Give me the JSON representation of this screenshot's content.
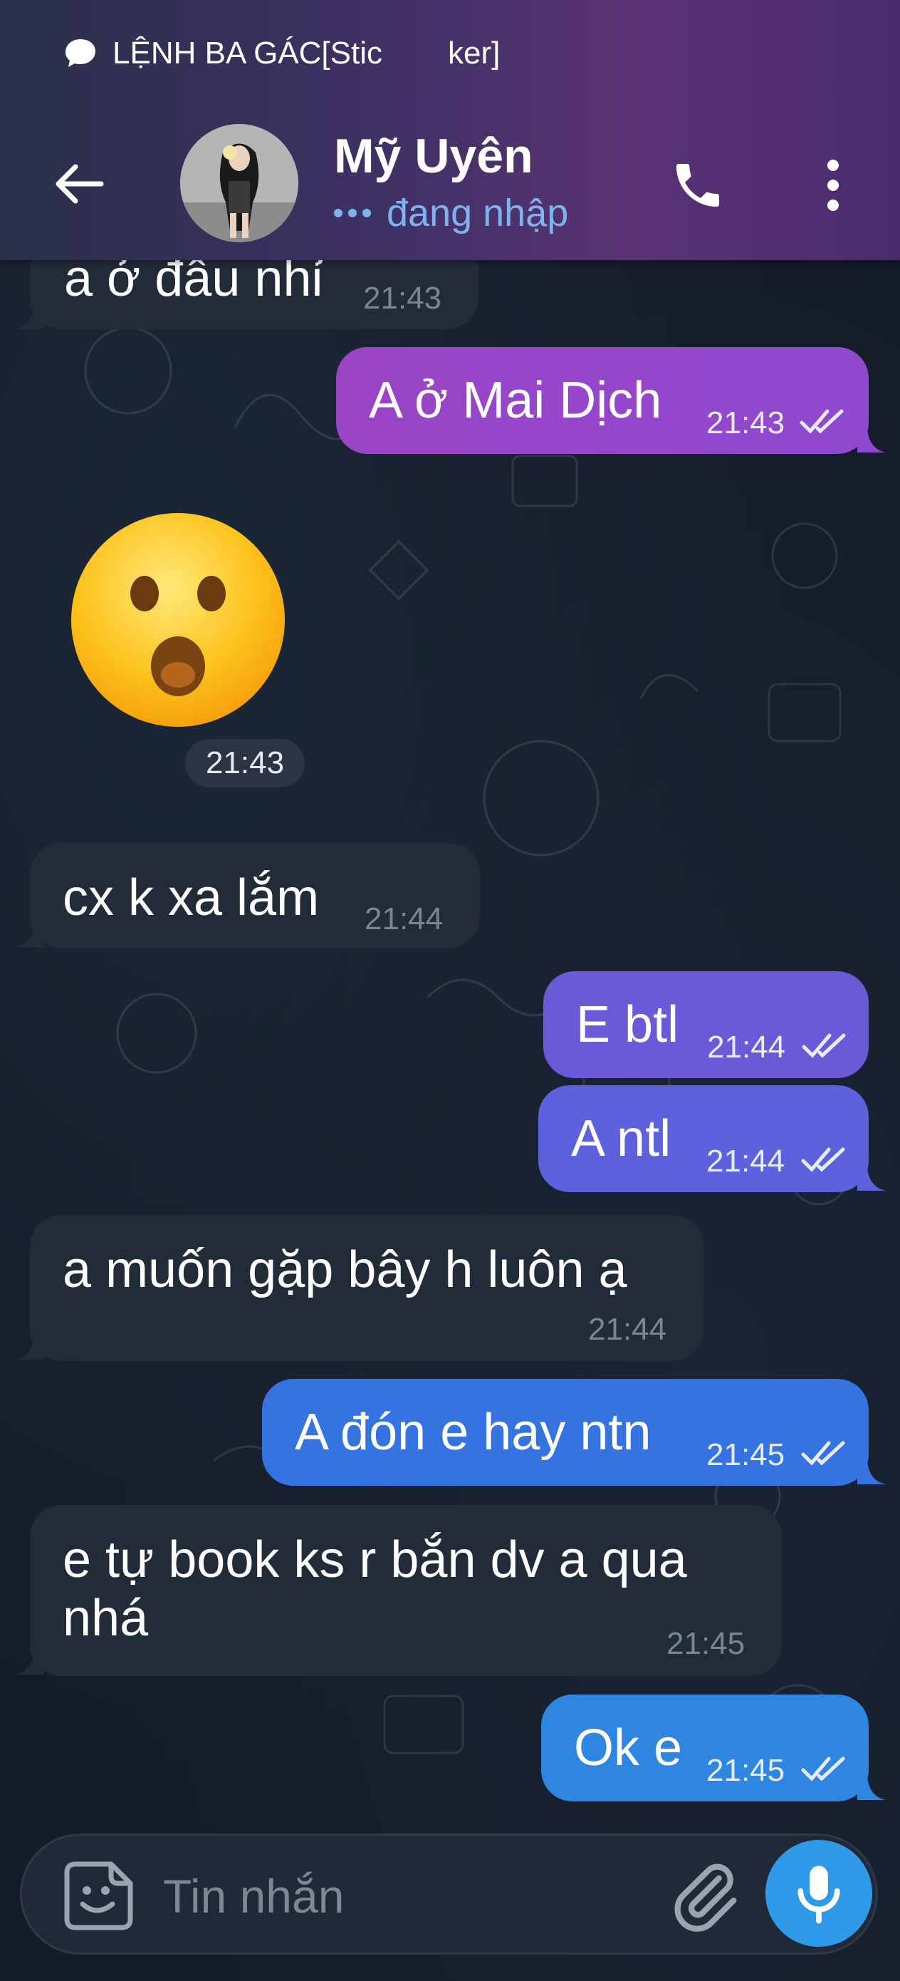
{
  "status_bar": {
    "notification_text_1": "LỆNH BA GÁC[Stic",
    "notification_text_2": "ker]"
  },
  "header": {
    "contact_name": "Mỹ Uyên",
    "contact_status": "đang nhập"
  },
  "messages": [
    {
      "direction": "incoming",
      "text": "a ở đâu nhỉ",
      "time": "21:43"
    },
    {
      "direction": "outgoing",
      "text": "A ở Mai Dịch",
      "time": "21:43"
    },
    {
      "direction": "incoming",
      "type": "sticker",
      "sticker": "astonished-face-emoji",
      "time": "21:43"
    },
    {
      "direction": "incoming",
      "text": "cx k xa lắm",
      "time": "21:44"
    },
    {
      "direction": "outgoing",
      "text": "E btl",
      "time": "21:44"
    },
    {
      "direction": "outgoing",
      "text": "A ntl",
      "time": "21:44"
    },
    {
      "direction": "incoming",
      "text": "a muốn gặp bây h luôn ạ",
      "time": "21:44"
    },
    {
      "direction": "outgoing",
      "text": "A đón e hay ntn",
      "time": "21:45"
    },
    {
      "direction": "incoming",
      "text_line_1": "e tự book ks r bắn dv a qua",
      "text_line_2": "nhá",
      "time": "21:45"
    },
    {
      "direction": "outgoing",
      "text": "Ok e",
      "time": "21:45"
    }
  ],
  "composer": {
    "placeholder": "Tin nhắn"
  },
  "icons": {
    "back": "arrow-left-icon",
    "call": "phone-icon",
    "menu": "more-vertical-icon",
    "emoji": "sticker-smile-icon",
    "attach": "paperclip-icon",
    "mic": "microphone-icon",
    "read_receipt": "double-check-icon"
  },
  "colors": {
    "header_gradient": [
      "#2a2f4a",
      "#593274"
    ],
    "outgoing_bubbles": [
      "#9b45c4",
      "#6b5ad8",
      "#5b62dc",
      "#3574e0",
      "#2f86e0"
    ],
    "incoming_bubble": "#222b38",
    "status_text": "#7fb3f0",
    "mic_button": "#2f9be8"
  }
}
